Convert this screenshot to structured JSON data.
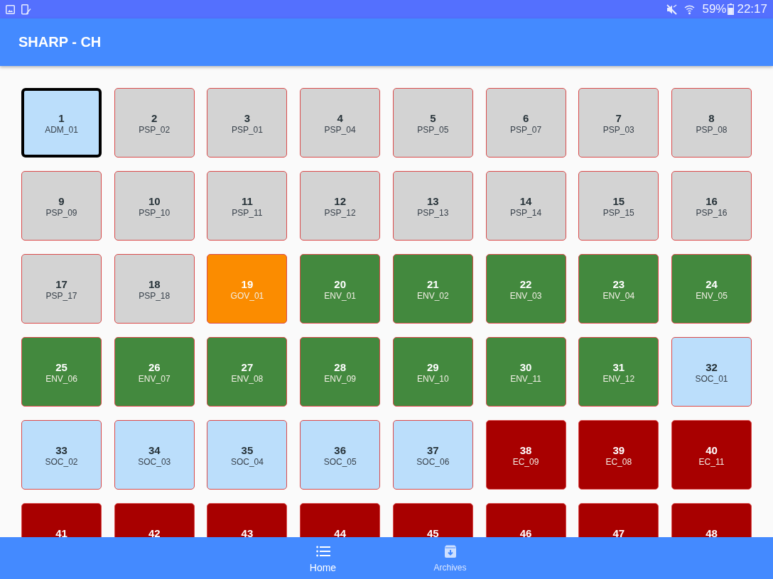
{
  "status_bar": {
    "battery": "59%",
    "time": "22:17"
  },
  "app_bar": {
    "title": "SHARP - CH"
  },
  "tiles": [
    {
      "number": "1",
      "label": "ADM_01",
      "color": "#bbdefb",
      "selected": true
    },
    {
      "number": "2",
      "label": "PSP_02",
      "color": "#d3d3d3",
      "selected": false
    },
    {
      "number": "3",
      "label": "PSP_01",
      "color": "#d3d3d3",
      "selected": false
    },
    {
      "number": "4",
      "label": "PSP_04",
      "color": "#d3d3d3",
      "selected": false
    },
    {
      "number": "5",
      "label": "PSP_05",
      "color": "#d3d3d3",
      "selected": false
    },
    {
      "number": "6",
      "label": "PSP_07",
      "color": "#d3d3d3",
      "selected": false
    },
    {
      "number": "7",
      "label": "PSP_03",
      "color": "#d3d3d3",
      "selected": false
    },
    {
      "number": "8",
      "label": "PSP_08",
      "color": "#d3d3d3",
      "selected": false
    },
    {
      "number": "9",
      "label": "PSP_09",
      "color": "#d3d3d3",
      "selected": false
    },
    {
      "number": "10",
      "label": "PSP_10",
      "color": "#d3d3d3",
      "selected": false
    },
    {
      "number": "11",
      "label": "PSP_11",
      "color": "#d3d3d3",
      "selected": false
    },
    {
      "number": "12",
      "label": "PSP_12",
      "color": "#d3d3d3",
      "selected": false
    },
    {
      "number": "13",
      "label": "PSP_13",
      "color": "#d3d3d3",
      "selected": false
    },
    {
      "number": "14",
      "label": "PSP_14",
      "color": "#d3d3d3",
      "selected": false
    },
    {
      "number": "15",
      "label": "PSP_15",
      "color": "#d3d3d3",
      "selected": false
    },
    {
      "number": "16",
      "label": "PSP_16",
      "color": "#d3d3d3",
      "selected": false
    },
    {
      "number": "17",
      "label": "PSP_17",
      "color": "#d3d3d3",
      "selected": false
    },
    {
      "number": "18",
      "label": "PSP_18",
      "color": "#d3d3d3",
      "selected": false
    },
    {
      "number": "19",
      "label": "GOV_01",
      "color": "#fb8c00",
      "selected": false
    },
    {
      "number": "20",
      "label": "ENV_01",
      "color": "#43893e",
      "selected": false
    },
    {
      "number": "21",
      "label": "ENV_02",
      "color": "#43893e",
      "selected": false
    },
    {
      "number": "22",
      "label": "ENV_03",
      "color": "#43893e",
      "selected": false
    },
    {
      "number": "23",
      "label": "ENV_04",
      "color": "#43893e",
      "selected": false
    },
    {
      "number": "24",
      "label": "ENV_05",
      "color": "#43893e",
      "selected": false
    },
    {
      "number": "25",
      "label": "ENV_06",
      "color": "#43893e",
      "selected": false
    },
    {
      "number": "26",
      "label": "ENV_07",
      "color": "#43893e",
      "selected": false
    },
    {
      "number": "27",
      "label": "ENV_08",
      "color": "#43893e",
      "selected": false
    },
    {
      "number": "28",
      "label": "ENV_09",
      "color": "#43893e",
      "selected": false
    },
    {
      "number": "29",
      "label": "ENV_10",
      "color": "#43893e",
      "selected": false
    },
    {
      "number": "30",
      "label": "ENV_11",
      "color": "#43893e",
      "selected": false
    },
    {
      "number": "31",
      "label": "ENV_12",
      "color": "#43893e",
      "selected": false
    },
    {
      "number": "32",
      "label": "SOC_01",
      "color": "#bbdefb",
      "selected": false
    },
    {
      "number": "33",
      "label": "SOC_02",
      "color": "#bbdefb",
      "selected": false
    },
    {
      "number": "34",
      "label": "SOC_03",
      "color": "#bbdefb",
      "selected": false
    },
    {
      "number": "35",
      "label": "SOC_04",
      "color": "#bbdefb",
      "selected": false
    },
    {
      "number": "36",
      "label": "SOC_05",
      "color": "#bbdefb",
      "selected": false
    },
    {
      "number": "37",
      "label": "SOC_06",
      "color": "#bbdefb",
      "selected": false
    },
    {
      "number": "38",
      "label": "EC_09",
      "color": "#a80000",
      "selected": false
    },
    {
      "number": "39",
      "label": "EC_08",
      "color": "#a80000",
      "selected": false
    },
    {
      "number": "40",
      "label": "EC_11",
      "color": "#a80000",
      "selected": false
    },
    {
      "number": "41",
      "color": "#a80000",
      "selected": false
    },
    {
      "number": "42",
      "color": "#a80000",
      "selected": false
    },
    {
      "number": "43",
      "color": "#a80000",
      "selected": false
    },
    {
      "number": "44",
      "color": "#a80000",
      "selected": false
    },
    {
      "number": "45",
      "color": "#a80000",
      "selected": false
    },
    {
      "number": "46",
      "color": "#a80000",
      "selected": false
    },
    {
      "number": "47",
      "color": "#a80000",
      "selected": false
    },
    {
      "number": "48",
      "color": "#a80000",
      "selected": false
    }
  ],
  "bottom_nav": [
    {
      "label": "Home",
      "selected": true
    },
    {
      "label": "Archives",
      "selected": false
    }
  ]
}
